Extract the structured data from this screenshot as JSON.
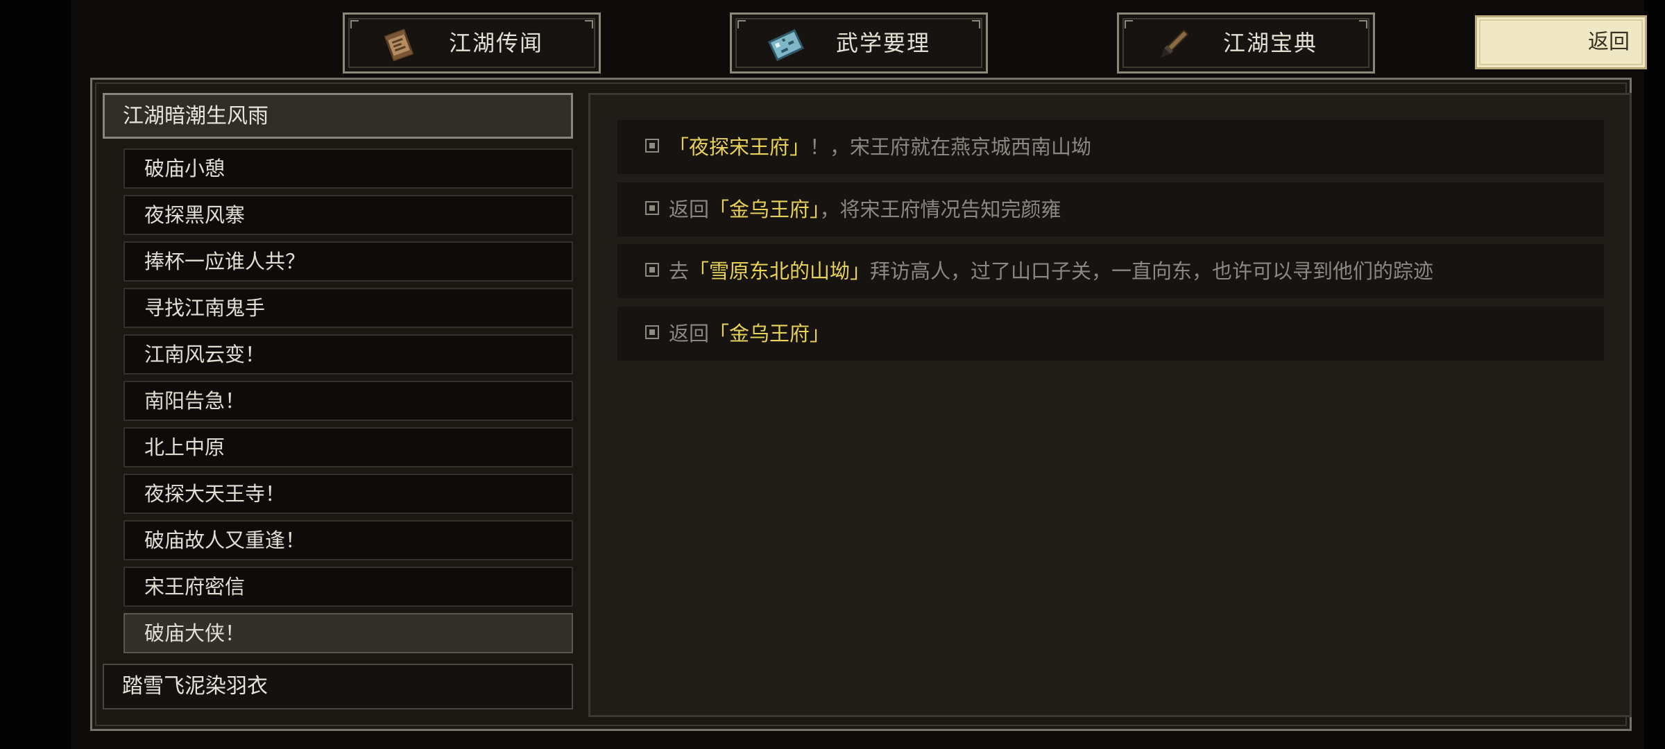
{
  "tabs": [
    {
      "label": "江湖传闻",
      "icon": "scroll-icon"
    },
    {
      "label": "武学要理",
      "icon": "map-icon"
    },
    {
      "label": "江湖宝典",
      "icon": "brush-icon"
    }
  ],
  "back_label": "返回",
  "chapters": [
    {
      "title": "江湖暗潮生风雨",
      "quests": [
        "破庙小憩",
        "夜探黑风寨",
        "捧杯一应谁人共？",
        "寻找江南鬼手",
        "江南风云变！",
        "南阳告急！",
        "北上中原",
        "夜探大天王寺！",
        "破庙故人又重逢！",
        "宋王府密信",
        "破庙大侠！"
      ]
    },
    {
      "title": "踏雪飞泥染羽衣",
      "quests": []
    }
  ],
  "selected_quest": "破庙大侠！",
  "tasks": [
    {
      "pre": "",
      "highlight": "「夜探宋王府」",
      "post": "！，宋王府就在燕京城西南山坳"
    },
    {
      "pre": "返回",
      "highlight": "「金乌王府」",
      "post": "，将宋王府情况告知完颜雍"
    },
    {
      "pre": "去",
      "highlight": "「雪原东北的山坳」",
      "post": "拜访高人，过了山口子关，一直向东，也许可以寻到他们的踪迹"
    },
    {
      "pre": "返回",
      "highlight": "「金乌王府」",
      "post": ""
    }
  ],
  "colors": {
    "highlight": "#e8d25a",
    "muted_text": "#8c8780",
    "back_button": "#f0e7c4"
  }
}
